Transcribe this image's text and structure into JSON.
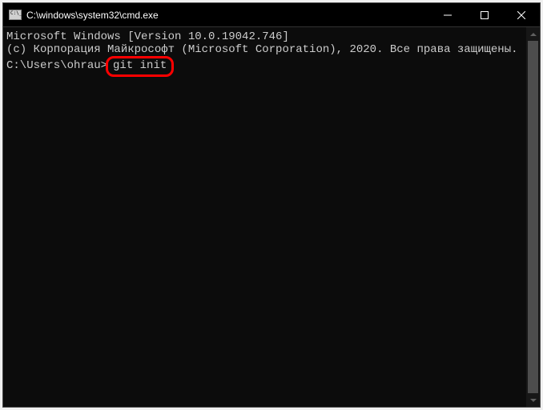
{
  "window": {
    "title": "C:\\windows\\system32\\cmd.exe"
  },
  "terminal": {
    "line1": "Microsoft Windows [Version 10.0.19042.746]",
    "line2": "(c) Корпорация Майкрософт (Microsoft Corporation), 2020. Все права защищены.",
    "blank": "",
    "prompt": "C:\\Users\\ohrau>",
    "command": "git init"
  }
}
